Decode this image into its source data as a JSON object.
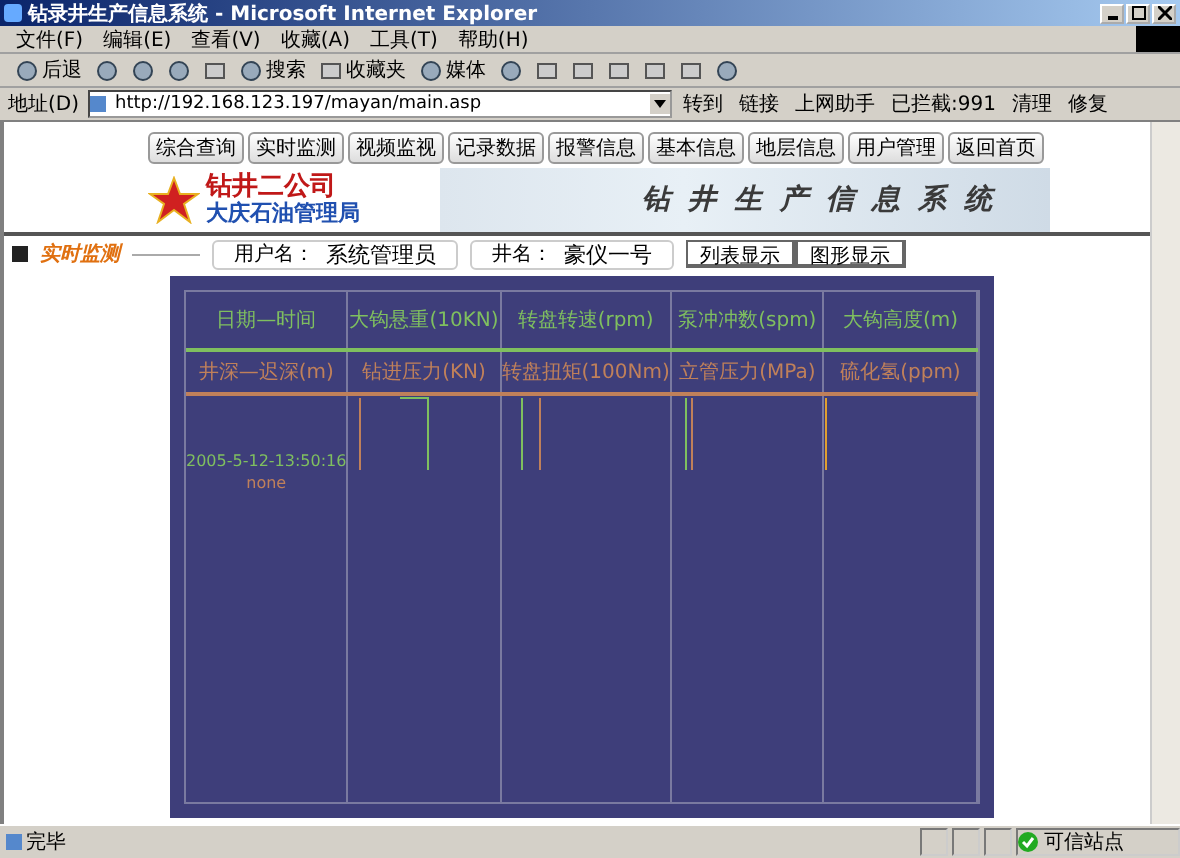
{
  "window": {
    "title": "钻录井生产信息系统 - Microsoft Internet Explorer"
  },
  "menu": [
    "文件(F)",
    "编辑(E)",
    "查看(V)",
    "收藏(A)",
    "工具(T)",
    "帮助(H)"
  ],
  "toolbar": [
    {
      "kind": "back",
      "label": "后退"
    },
    {
      "kind": "forward"
    },
    {
      "kind": "stop"
    },
    {
      "kind": "refresh"
    },
    {
      "kind": "home"
    },
    {
      "kind": "search",
      "label": "搜索"
    },
    {
      "kind": "favorites",
      "label": "收藏夹"
    },
    {
      "kind": "media",
      "label": "媒体"
    },
    {
      "kind": "history"
    },
    {
      "kind": "mail"
    },
    {
      "kind": "print"
    },
    {
      "kind": "edit"
    },
    {
      "kind": "discuss"
    },
    {
      "kind": "messenger"
    },
    {
      "kind": "research"
    }
  ],
  "address": {
    "label": "地址(D)",
    "value": "http://192.168.123.197/mayan/main.asp",
    "go": "转到",
    "links": "链接",
    "helper": "上网助手",
    "blocked": "已拦截:991",
    "clean": "清理",
    "repair": "修复"
  },
  "nav": [
    "综合查询",
    "实时监测",
    "视频监视",
    "记录数据",
    "报警信息",
    "基本信息",
    "地层信息",
    "用户管理",
    "返回首页"
  ],
  "logo": {
    "company": "钻井二公司",
    "bureau": "大庆石油管理局",
    "banner": "钻井生产信息系统"
  },
  "section": {
    "title": "实时监测",
    "user_label": "用户名：",
    "user": "系统管理员",
    "well_label": "井名：",
    "well": "豪仪一号",
    "buttons": [
      {
        "label": "列表显示"
      },
      {
        "label": "图形显示"
      }
    ]
  },
  "table": {
    "header_rows": [
      {
        "color": "#7fbf5f",
        "cells": [
          "日期—时间",
          "大钩悬重(10KN)",
          "转盘转速(rpm)",
          "泵冲冲数(spm)",
          "大钩高度(m)"
        ]
      },
      {
        "color": "#c0805a",
        "cells": [
          "井深—迟深(m)",
          "钻进压力(KN)",
          "转盘扭矩(100Nm)",
          "立管压力(MPa)",
          "硫化氢(ppm)"
        ]
      }
    ],
    "time": "2005-5-12-13:50:16",
    "status": "none"
  },
  "status_bar": {
    "text": "完毕",
    "zone": "可信站点"
  }
}
